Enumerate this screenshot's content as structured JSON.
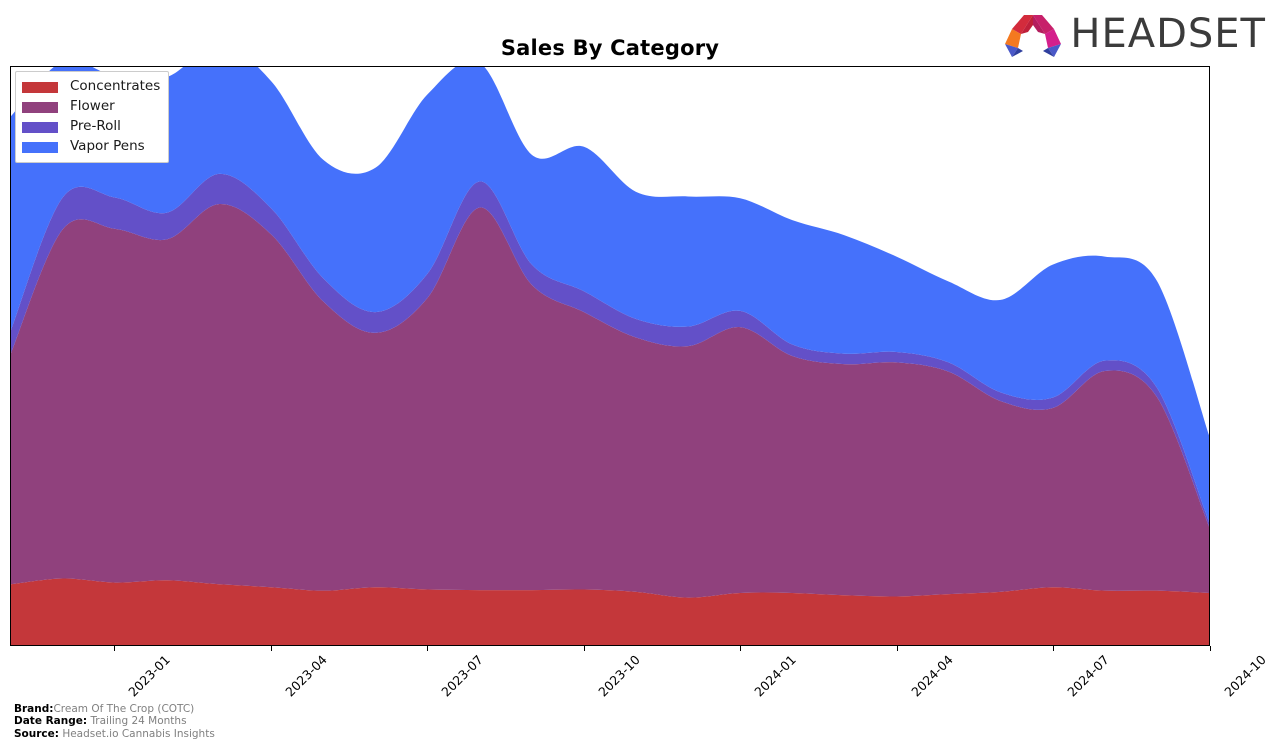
{
  "header": {
    "title": "Sales By Category",
    "logo_word": "HEADSET",
    "logo_mark_name": "headset-arch-logo"
  },
  "legend": {
    "position": "top-left-inside",
    "items": [
      {
        "label": "Concentrates",
        "color": "#c4373a"
      },
      {
        "label": "Flower",
        "color": "#90417d"
      },
      {
        "label": "Pre-Roll",
        "color": "#6350c8"
      },
      {
        "label": "Vapor Pens",
        "color": "#4571fb"
      }
    ]
  },
  "footer": {
    "brand_key": "Brand:",
    "brand_value": "Cream Of The Crop (COTC)",
    "date_range_key": "Date Range:",
    "date_range_value": "Trailing 24 Months",
    "source_key": "Source:",
    "source_value": "Headset.io Cannabis Insights"
  },
  "chart_data": {
    "type": "area",
    "stacked": true,
    "interpolation": "smooth-spline",
    "title": "Sales By Category",
    "xlabel": "",
    "ylabel": "",
    "grid": false,
    "legend_position": "upper left",
    "axis": {
      "x_tick_labels": [
        "2023-01",
        "2023-04",
        "2023-07",
        "2023-10",
        "2024-01",
        "2024-04",
        "2024-07",
        "2024-10"
      ],
      "x_tick_index": [
        2,
        5,
        8,
        11,
        14,
        17,
        20,
        23
      ],
      "y_axis_visible": false,
      "ylim": [
        0,
        100
      ]
    },
    "x": [
      "2022-11",
      "2022-12",
      "2023-01",
      "2023-02",
      "2023-03",
      "2023-04",
      "2023-05",
      "2023-06",
      "2023-07",
      "2023-08",
      "2023-09",
      "2023-10",
      "2023-11",
      "2023-12",
      "2024-01",
      "2024-02",
      "2024-03",
      "2024-04",
      "2024-05",
      "2024-06",
      "2024-07",
      "2024-08",
      "2024-09",
      "2024-10"
    ],
    "categories": [
      "2022-11",
      "2022-12",
      "2023-01",
      "2023-02",
      "2023-03",
      "2023-04",
      "2023-05",
      "2023-06",
      "2023-07",
      "2023-08",
      "2023-09",
      "2023-10",
      "2023-11",
      "2023-12",
      "2024-01",
      "2024-02",
      "2024-03",
      "2024-04",
      "2024-05",
      "2024-06",
      "2024-07",
      "2024-08",
      "2024-09",
      "2024-10"
    ],
    "series": [
      {
        "name": "Concentrates",
        "color": "#c4373a",
        "values": [
          10.5,
          11.5,
          10.8,
          11.2,
          10.5,
          10.0,
          9.4,
          10.0,
          9.6,
          9.5,
          9.5,
          9.6,
          9.2,
          8.2,
          9.0,
          9.0,
          8.6,
          8.4,
          8.8,
          9.2,
          10.0,
          9.4,
          9.4,
          9.0
        ]
      },
      {
        "name": "Flower",
        "color": "#90417d",
        "values": [
          40.0,
          60.5,
          61.2,
          59.0,
          65.8,
          61.0,
          50.0,
          44.0,
          50.5,
          66.2,
          52.8,
          48.0,
          44.0,
          43.5,
          46.0,
          41.0,
          40.0,
          40.5,
          38.5,
          33.0,
          31.0,
          38.0,
          33.5,
          11.5
        ]
      },
      {
        "name": "Pre-Roll",
        "color": "#6350c8",
        "values": [
          4.0,
          5.5,
          5.4,
          4.6,
          5.2,
          4.5,
          4.0,
          3.6,
          4.2,
          4.5,
          3.5,
          3.6,
          3.2,
          3.4,
          2.8,
          2.0,
          1.8,
          1.8,
          1.6,
          1.5,
          1.8,
          1.8,
          1.6,
          0.8
        ]
      },
      {
        "name": "Vapor Pens",
        "color": "#4571fb",
        "values": [
          37.0,
          23.5,
          21.0,
          23.5,
          22.5,
          22.0,
          20.5,
          25.0,
          31.0,
          20.5,
          19.0,
          25.0,
          22.0,
          22.5,
          19.5,
          21.5,
          20.5,
          16.5,
          14.0,
          16.0,
          23.0,
          18.0,
          18.5,
          15.0
        ]
      }
    ]
  }
}
